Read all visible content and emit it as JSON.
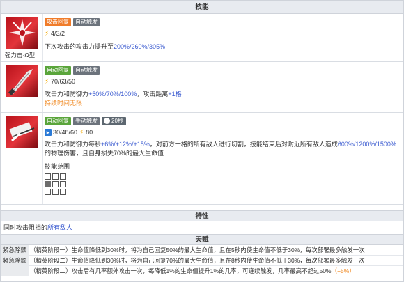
{
  "sections": {
    "skills_title": "技能",
    "traits_title": "特性",
    "talents_title": "天赋"
  },
  "skills": [
    {
      "name": "强力击·Ω型",
      "tags": [
        "攻击回复",
        "自动触发"
      ],
      "sp": "4/3/2",
      "desc_prefix": "下次攻击的攻击力提升至",
      "desc_values": "200%/260%/305%",
      "colors": {
        "tag1": "#f07c2a",
        "tag2": "#6c737c"
      }
    },
    {
      "name": "",
      "tags": [
        "自动回复",
        "自动触发"
      ],
      "sp": "70/63/50",
      "desc_prefix": "攻击力和防御力",
      "desc_values": "+50%/70%/100%",
      "desc_mid": "，攻击距离",
      "desc_range": "+1格",
      "note": "持续时间无限",
      "colors": {
        "tag1": "#5aa53b",
        "tag2": "#6c737c"
      }
    },
    {
      "name": "",
      "tags": [
        "自动回复",
        "手动触发"
      ],
      "duration": "20秒",
      "sp_initial": "30/48/60",
      "sp_cost": "80",
      "desc_a": "攻击力和防御力每秒",
      "desc_a_val": "+6%/+12%/+15%",
      "desc_b": "，对前方一格的所有敌人进行切割，技能结束后对附近所有敌人造成",
      "desc_b_val": "600%/1200%/1500%",
      "desc_c": "的物理伤害，且自身损失70%的最大生命值",
      "range_title": "技能范围",
      "colors": {
        "tag1": "#5aa53b",
        "tag2": "#6c737c",
        "duration_bg": "#5d6770"
      }
    }
  ],
  "trait": {
    "prefix": "同时攻击阻挡的",
    "link": "所有敌人"
  },
  "talents": [
    {
      "name": "紧急除颤",
      "desc": "（精英阶段一）生命值降低到30%时，将为自己回复50%的最大生命值，且在5秒内使生命值不低于30%，每次部署最多触发一次"
    },
    {
      "name": "紧急除颤",
      "desc": "（精英阶段二）生命值降低到30%时，将为自己回复70%的最大生命值，且在8秒内使生命值不低于30%，每次部署最多触发一次"
    },
    {
      "name": "",
      "desc": "（精英阶段二）攻击后有几率额外攻击一次，每降低1%的生命值提升1%的几率，可连续触发，几率最高不超过50%",
      "extra": "（+5%）"
    }
  ]
}
